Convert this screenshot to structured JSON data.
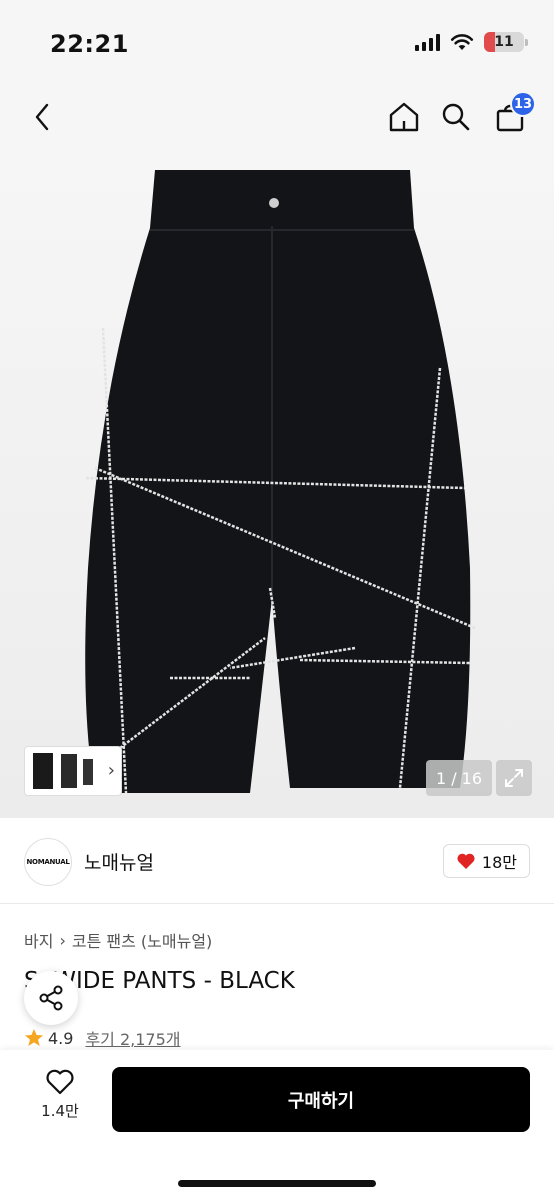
{
  "status_bar": {
    "time": "22:21",
    "battery": "11"
  },
  "nav": {
    "cart_count": "13"
  },
  "gallery": {
    "counter": "1 / 16"
  },
  "brand": {
    "logo_text": "NOMANUAL",
    "name": "노매뉴얼",
    "likes": "18만"
  },
  "product": {
    "breadcrumb": [
      "바지",
      "코튼 팬츠 (노매뉴얼)"
    ],
    "title": "S.  WIDE PANTS - BLACK",
    "rating": "4.9",
    "reviews": "후기 2,175개"
  },
  "bottom": {
    "wish_count": "1.4만",
    "buy_label": "구매하기"
  },
  "colors": {
    "accent_blue": "#2c63e8",
    "heart_red": "#e02424",
    "star": "#f5a623",
    "buy_button": "#000000"
  }
}
